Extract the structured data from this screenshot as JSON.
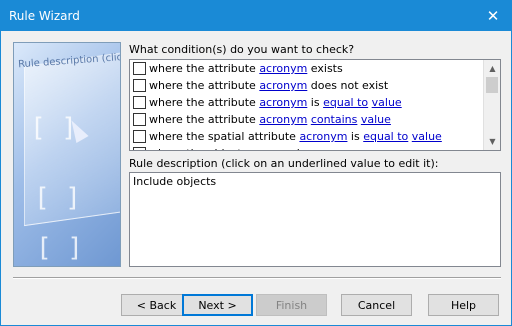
{
  "window": {
    "title": "Rule Wizard",
    "close_icon": "close-icon"
  },
  "art": {
    "caption": "Rule description (click on"
  },
  "conditions": {
    "label": "What condition(s) do you want to check?",
    "items": [
      {
        "parts": [
          {
            "t": "where the attribute "
          },
          {
            "t": "acronym",
            "link": true
          },
          {
            "t": " exists"
          }
        ]
      },
      {
        "parts": [
          {
            "t": "where the attribute "
          },
          {
            "t": "acronym",
            "link": true
          },
          {
            "t": " does not exist"
          }
        ]
      },
      {
        "parts": [
          {
            "t": "where the attribute "
          },
          {
            "t": "acronym",
            "link": true
          },
          {
            "t": " is "
          },
          {
            "t": "equal to",
            "link": true
          },
          {
            "t": " "
          },
          {
            "t": "value",
            "link": true
          }
        ]
      },
      {
        "parts": [
          {
            "t": "where the attribute "
          },
          {
            "t": "acronym",
            "link": true
          },
          {
            "t": " "
          },
          {
            "t": "contains",
            "link": true
          },
          {
            "t": " "
          },
          {
            "t": "value",
            "link": true
          }
        ]
      },
      {
        "parts": [
          {
            "t": "where the spatial attribute "
          },
          {
            "t": "acronym",
            "link": true
          },
          {
            "t": " is "
          },
          {
            "t": "equal to",
            "link": true
          },
          {
            "t": " "
          },
          {
            "t": "value",
            "link": true
          }
        ]
      },
      {
        "parts": [
          {
            "t": "where the object acronym is "
          },
          {
            "t": "acronym",
            "link": true
          }
        ]
      }
    ]
  },
  "description": {
    "label": "Rule description (click on an underlined value to edit it):",
    "text": "Include objects"
  },
  "buttons": {
    "back": "< Back",
    "next": "Next >",
    "finish": "Finish",
    "cancel": "Cancel",
    "help": "Help"
  },
  "colors": {
    "titlebar": "#1a8ad6",
    "link": "#0000cc"
  }
}
